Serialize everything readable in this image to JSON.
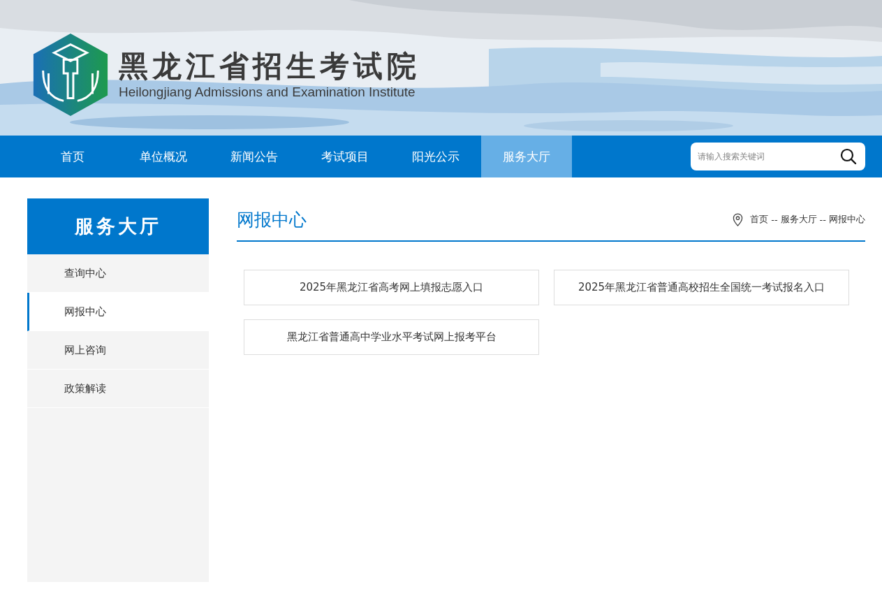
{
  "header": {
    "logo_title": "黑龙江省招生考试院",
    "logo_subtitle": "Heilongjiang Admissions and Examination Institute"
  },
  "nav": [
    {
      "label": "首页",
      "selected": false
    },
    {
      "label": "单位概况",
      "selected": false
    },
    {
      "label": "新闻公告",
      "selected": false
    },
    {
      "label": "考试项目",
      "selected": false
    },
    {
      "label": "阳光公示",
      "selected": false
    },
    {
      "label": "服务大厅",
      "selected": true
    }
  ],
  "search": {
    "placeholder": "请输入搜索关键词"
  },
  "sidebar": {
    "title": "服务大厅",
    "items": [
      {
        "label": "查询中心",
        "selected": false
      },
      {
        "label": "网报中心",
        "selected": true
      },
      {
        "label": "网上咨询",
        "selected": false
      },
      {
        "label": "政策解读",
        "selected": false
      }
    ]
  },
  "content": {
    "title": "网报中心",
    "breadcrumb": {
      "items": [
        "首页",
        "服务大厅",
        "网报中心"
      ],
      "separator": "--"
    },
    "links": [
      "2025年黑龙江省高考网上填报志愿入口",
      "2025年黑龙江省普通高校招生全国统一考试报名入口",
      "黑龙江省普通高中学业水平考试网上报考平台"
    ]
  }
}
